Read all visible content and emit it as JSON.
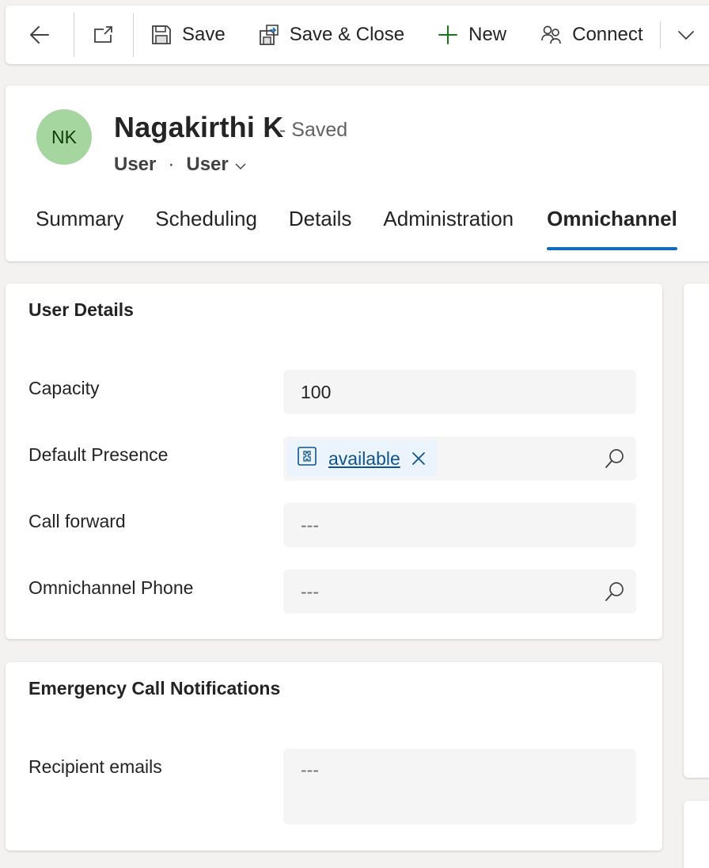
{
  "toolbar": {
    "save_label": "Save",
    "save_close_label": "Save & Close",
    "new_label": "New",
    "connect_label": "Connect"
  },
  "header": {
    "initials": "NK",
    "name": "Nagakirthi K",
    "status": "- Saved",
    "entity": "User",
    "form": "User",
    "tabs": [
      "Summary",
      "Scheduling",
      "Details",
      "Administration",
      "Omnichannel"
    ],
    "active_tab": "Omnichannel"
  },
  "user_details": {
    "title": "User Details",
    "capacity_label": "Capacity",
    "capacity_value": "100",
    "default_presence_label": "Default Presence",
    "default_presence_value": "available",
    "call_forward_label": "Call forward",
    "call_forward_value": "---",
    "omnichannel_phone_label": "Omnichannel Phone",
    "omnichannel_phone_value": "---"
  },
  "emergency": {
    "title": "Emergency Call Notifications",
    "recipient_label": "Recipient emails",
    "recipient_value": "---"
  },
  "colors": {
    "accent": "#0f6cbd",
    "avatar_bg": "#a6d6a0",
    "new_icon": "#107c10",
    "tag_bg": "#ebf3fc"
  },
  "icons": [
    "back-arrow-icon",
    "open-in-new-window-icon",
    "save-icon",
    "save-close-icon",
    "plus-icon",
    "connect-people-icon",
    "chevron-down-icon",
    "presence-entity-icon",
    "close-icon",
    "search-icon"
  ]
}
